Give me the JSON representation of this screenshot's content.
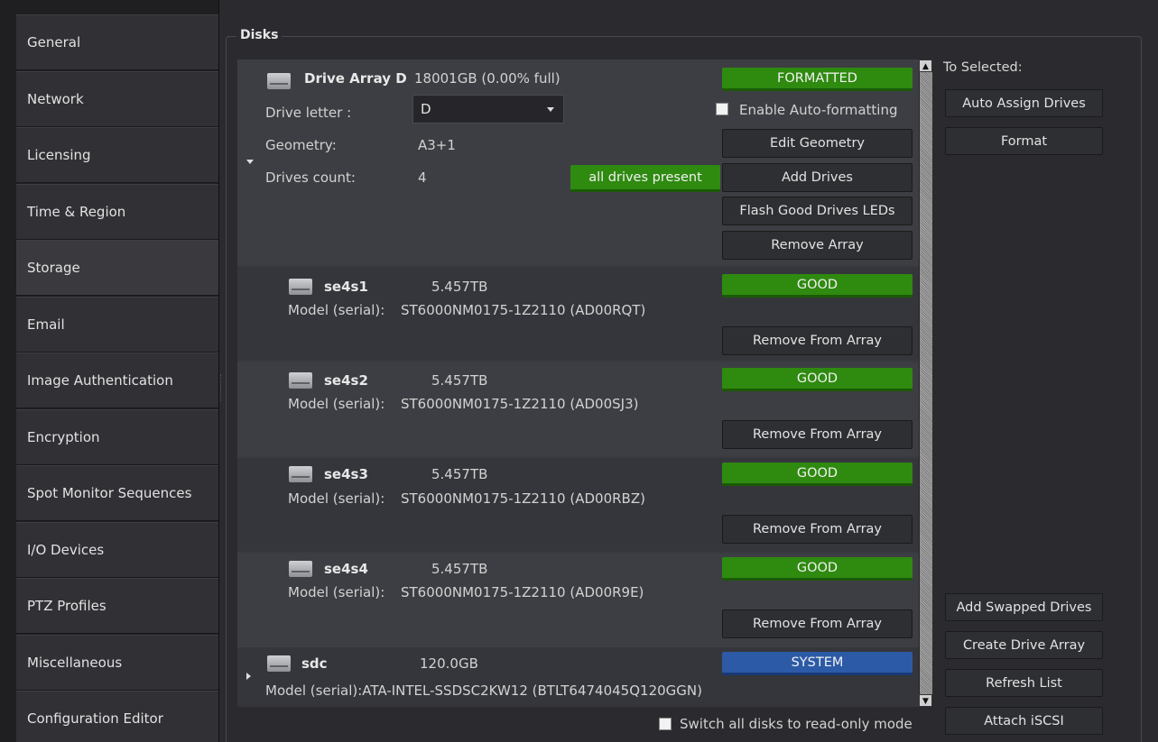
{
  "sidebar": {
    "items": [
      {
        "label": "General"
      },
      {
        "label": "Network"
      },
      {
        "label": "Licensing"
      },
      {
        "label": "Time & Region"
      },
      {
        "label": "Storage"
      },
      {
        "label": "Email"
      },
      {
        "label": "Image Authentication"
      },
      {
        "label": "Encryption"
      },
      {
        "label": "Spot Monitor Sequences"
      },
      {
        "label": "I/O Devices"
      },
      {
        "label": "PTZ Profiles"
      },
      {
        "label": "Miscellaneous"
      },
      {
        "label": "Configuration Editor"
      }
    ],
    "active": "Storage"
  },
  "disks": {
    "title": "Disks",
    "array": {
      "name": "Drive Array D",
      "info": "18001GB (0.00% full)",
      "status": "FORMATTED",
      "drive_letter_label": "Drive letter :",
      "drive_letter": "D",
      "geometry_label": "Geometry:",
      "geometry": "A3+1",
      "drives_count_label": "Drives count:",
      "drives_count": "4",
      "drives_status": "all drives present",
      "auto_format_label": "Enable Auto-formatting",
      "auto_format_checked": false,
      "buttons": {
        "edit_geometry": "Edit Geometry",
        "add_drives": "Add Drives",
        "flash_leds": "Flash Good Drives LEDs",
        "remove_array": "Remove Array"
      }
    },
    "drives": [
      {
        "name": "se4s1",
        "size": "5.457TB",
        "model_label": "Model (serial):",
        "model": "ST6000NM0175-1Z2110 (AD00RQT)",
        "status": "GOOD",
        "remove": "Remove From Array"
      },
      {
        "name": "se4s2",
        "size": "5.457TB",
        "model_label": "Model (serial):",
        "model": "ST6000NM0175-1Z2110 (AD00SJ3)",
        "status": "GOOD",
        "remove": "Remove From Array"
      },
      {
        "name": "se4s3",
        "size": "5.457TB",
        "model_label": "Model (serial):",
        "model": "ST6000NM0175-1Z2110 (AD00RBZ)",
        "status": "GOOD",
        "remove": "Remove From Array"
      },
      {
        "name": "se4s4",
        "size": "5.457TB",
        "model_label": "Model (serial):",
        "model": "ST6000NM0175-1Z2110 (AD00R9E)",
        "status": "GOOD",
        "remove": "Remove From Array"
      }
    ],
    "system_disk": {
      "name": "sdc",
      "size": "120.0GB",
      "model": "Model (serial):ATA-INTEL-SSDSC2KW12 (BTLT6474045Q120GGN)",
      "status": "SYSTEM"
    },
    "read_only_label": "Switch all disks to read-only mode",
    "read_only_checked": false
  },
  "actions": {
    "to_selected_label": "To Selected:",
    "auto_assign": "Auto Assign Drives",
    "format": "Format",
    "add_swapped": "Add Swapped Drives",
    "create_array": "Create Drive Array",
    "refresh": "Refresh List",
    "attach_iscsi": "Attach iSCSI"
  },
  "colors": {
    "good": "#2f8a10",
    "system": "#2c5aa6",
    "background": "#2b2b2f",
    "list_background": "#3a3b40"
  }
}
